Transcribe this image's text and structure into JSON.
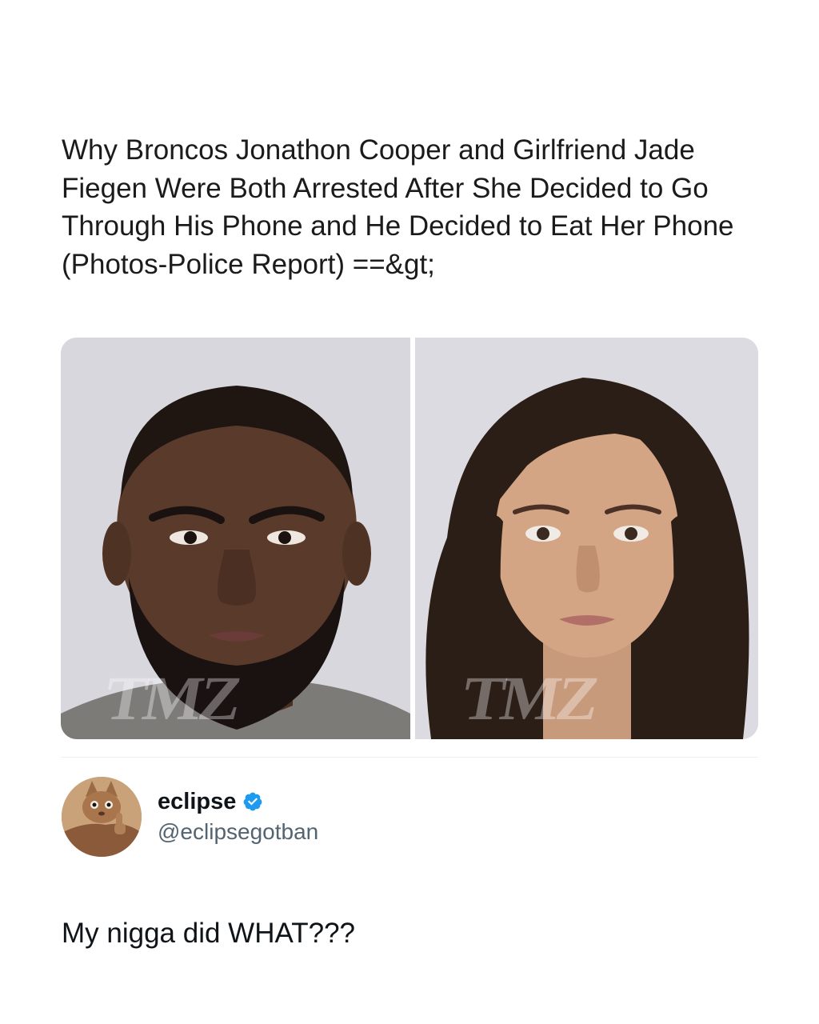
{
  "article": {
    "headline": "Why Broncos Jonathon Cooper and Girlfriend Jade Fiegen Were Both Arrested After She Decided to Go Through His Phone and He Decided to Eat Her Phone (Photos-Police Report) ==&gt;"
  },
  "media": {
    "left_watermark": "TMZ",
    "right_watermark": "TMZ"
  },
  "author": {
    "display_name": "eclipse",
    "handle": "@eclipsegotban",
    "verified": true,
    "verified_color": "#1d9bf0"
  },
  "tweet": {
    "text": "My nigga did WHAT???"
  },
  "colors": {
    "background": "#ffffff",
    "text": "#0f1419",
    "handle": "#536471",
    "divider": "#eceff1"
  }
}
